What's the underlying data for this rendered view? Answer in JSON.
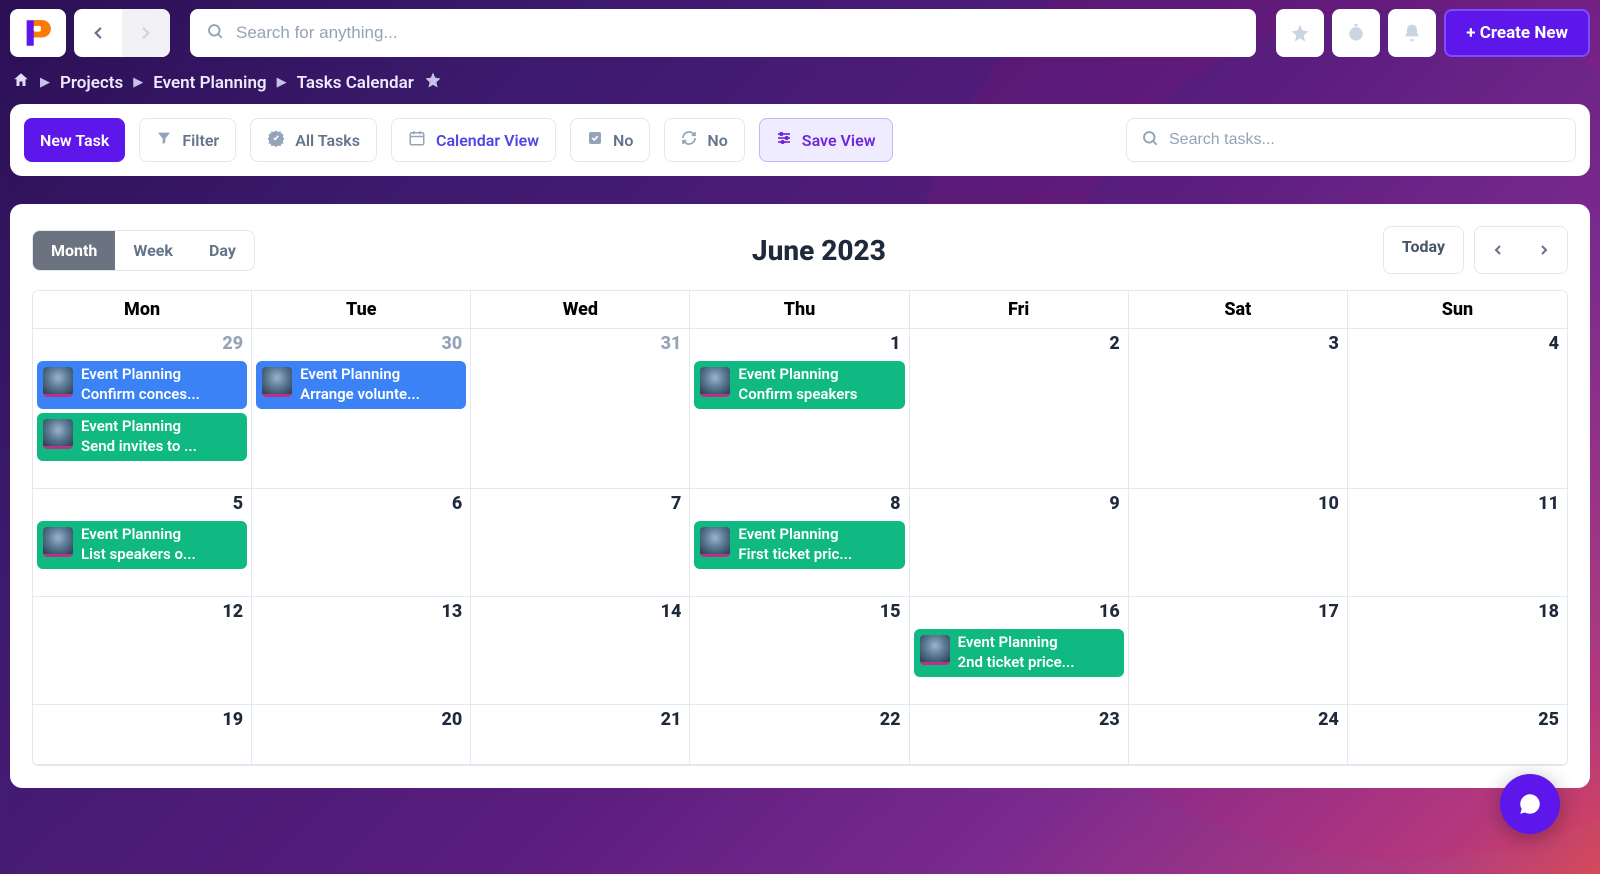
{
  "topbar": {
    "search_placeholder": "Search for anything...",
    "create_label": "+ Create New"
  },
  "breadcrumb": {
    "items": [
      "Projects",
      "Event Planning",
      "Tasks Calendar"
    ]
  },
  "toolbar": {
    "new_task": "New Task",
    "filter": "Filter",
    "all_tasks": "All Tasks",
    "calendar_view": "Calendar View",
    "no1": "No",
    "no2": "No",
    "save_view": "Save View",
    "search_placeholder": "Search tasks..."
  },
  "calendar": {
    "title": "June 2023",
    "views": {
      "month": "Month",
      "week": "Week",
      "day": "Day"
    },
    "today": "Today",
    "day_headers": [
      "Mon",
      "Tue",
      "Wed",
      "Thu",
      "Fri",
      "Sat",
      "Sun"
    ],
    "cells": [
      {
        "num": "29",
        "muted": true,
        "events": [
          {
            "color": "blue",
            "project": "Event Planning",
            "title": "Confirm conces..."
          },
          {
            "color": "green",
            "project": "Event Planning",
            "title": "Send invites to ..."
          }
        ]
      },
      {
        "num": "30",
        "muted": true,
        "events": [
          {
            "color": "blue",
            "project": "Event Planning",
            "title": "Arrange volunte..."
          }
        ]
      },
      {
        "num": "31",
        "muted": true
      },
      {
        "num": "1",
        "events": [
          {
            "color": "green",
            "project": "Event Planning",
            "title": "Confirm speakers"
          }
        ]
      },
      {
        "num": "2"
      },
      {
        "num": "3"
      },
      {
        "num": "4"
      },
      {
        "num": "5",
        "events": [
          {
            "color": "green",
            "project": "Event Planning",
            "title": "List speakers o..."
          }
        ]
      },
      {
        "num": "6"
      },
      {
        "num": "7"
      },
      {
        "num": "8",
        "events": [
          {
            "color": "green",
            "project": "Event Planning",
            "title": "First ticket pric..."
          }
        ]
      },
      {
        "num": "9"
      },
      {
        "num": "10"
      },
      {
        "num": "11"
      },
      {
        "num": "12"
      },
      {
        "num": "13"
      },
      {
        "num": "14"
      },
      {
        "num": "15"
      },
      {
        "num": "16",
        "events": [
          {
            "color": "green",
            "project": "Event Planning",
            "title": "2nd ticket price..."
          }
        ]
      },
      {
        "num": "17"
      },
      {
        "num": "18"
      },
      {
        "num": "19"
      },
      {
        "num": "20"
      },
      {
        "num": "21"
      },
      {
        "num": "22"
      },
      {
        "num": "23"
      },
      {
        "num": "24"
      },
      {
        "num": "25"
      }
    ]
  }
}
